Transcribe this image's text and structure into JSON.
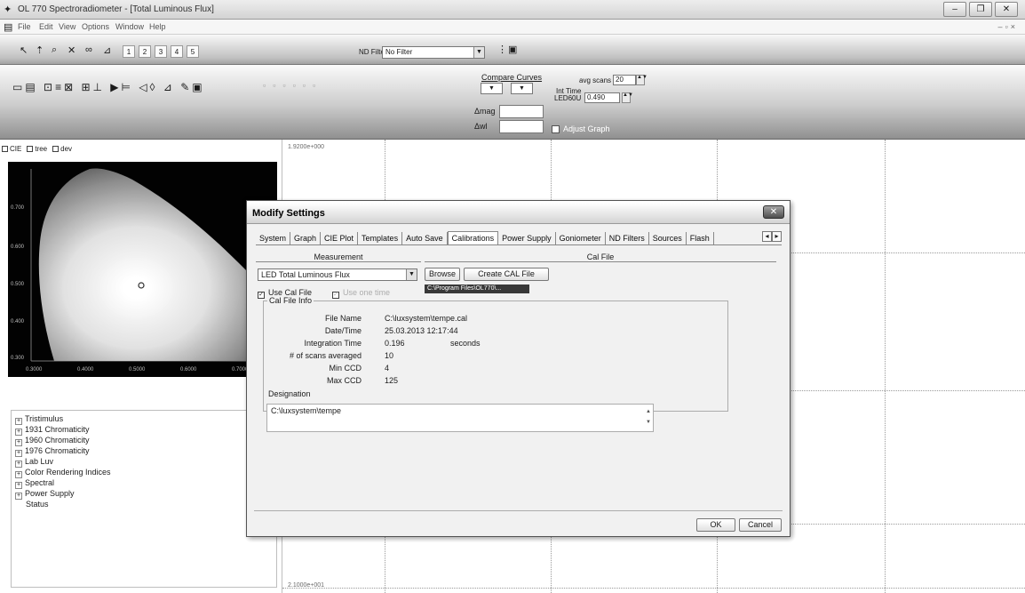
{
  "window": {
    "title": "OL 770 Spectroradiometer - [Total Luminous Flux]",
    "controls": [
      "–",
      "❐",
      "✕"
    ]
  },
  "menu": [
    "File",
    "Edit",
    "View",
    "Options",
    "Window",
    "Help"
  ],
  "toolbar": {
    "numbers": [
      "1",
      "2",
      "3",
      "4",
      "5"
    ],
    "nd_filter_label": "ND Filter",
    "nd_filter_value": "No Filter",
    "compare_curves_label": "Compare Curves",
    "delta_mag_label": "Δmag",
    "delta_wl_label": "Δwl",
    "avg_scans_label": "avg scans",
    "avg_scans_value": "20",
    "int_time_label": "Int Time",
    "int_time_sub": "LED60U",
    "int_time_value": "0.490",
    "adjust_graph_label": "Adjust Graph"
  },
  "cie_panel": {
    "checkboxes": [
      "CIE",
      "tree",
      "dev"
    ],
    "y_ticks": [
      "0.700",
      "0.600",
      "0.500",
      "0.400",
      "0.300"
    ],
    "x_ticks": [
      "0.3000",
      "0.4000",
      "0.5000",
      "0.6000",
      "0.7000"
    ]
  },
  "tree": [
    "Tristimulus",
    "1931 Chromaticity",
    "1960 Chromaticity",
    "1976 Chromaticity",
    "Lab Luv",
    "Color Rendering Indices",
    "Spectral",
    "Power Supply",
    "Status"
  ],
  "graph": {
    "y_top": "1.9200e+000",
    "y_bottom": "2.1000e+001"
  },
  "dialog": {
    "title": "Modify Settings",
    "tabs": [
      "System",
      "Graph",
      "CIE Plot",
      "Templates",
      "Auto Save",
      "Calibrations",
      "Power Supply",
      "Goniometer",
      "ND Filters",
      "Sources",
      "Flash"
    ],
    "active_tab": "Calibrations",
    "measurement_label": "Measurement",
    "cal_file_label": "Cal File",
    "measurement_value": "LED Total Luminous Flux",
    "browse_label": "Browse",
    "create_cal_label": "Create CAL File",
    "cal_path": "C:\\Program Files\\OL770\\...",
    "use_cal_file_label": "Use Cal File",
    "use_one_time_label": "Use one time",
    "cal_file_info_label": "Cal File Info",
    "info": [
      {
        "label": "File Name",
        "value": "C:\\luxsystem\\tempe.cal",
        "unit": ""
      },
      {
        "label": "Date/Time",
        "value": "25.03.2013 12:17:44",
        "unit": ""
      },
      {
        "label": "Integration Time",
        "value": "0.196",
        "unit": "seconds"
      },
      {
        "label": "# of scans averaged",
        "value": "10",
        "unit": ""
      },
      {
        "label": "Min CCD",
        "value": "4",
        "unit": ""
      },
      {
        "label": "Max CCD",
        "value": "125",
        "unit": ""
      }
    ],
    "designation_label": "Designation",
    "designation_value": "C:\\luxsystem\\tempe",
    "ok_label": "OK",
    "cancel_label": "Cancel"
  }
}
